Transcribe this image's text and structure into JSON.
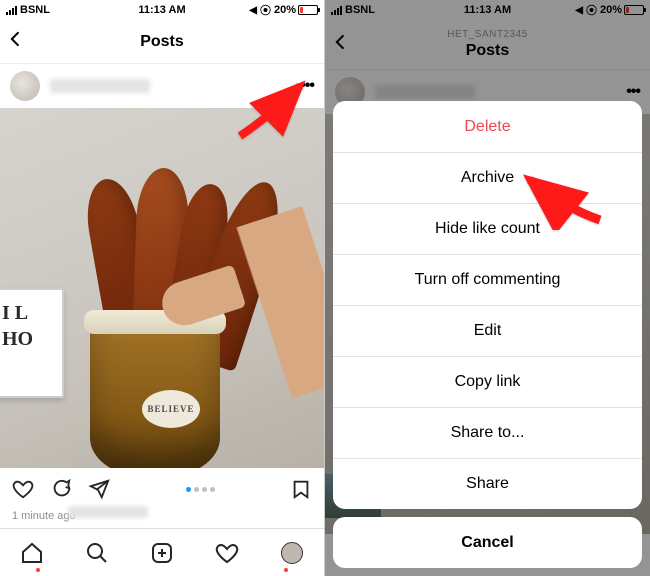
{
  "status": {
    "carrier": "BSNL",
    "time": "11:13 AM",
    "battery_pct": "20%"
  },
  "left": {
    "header": {
      "title": "Posts"
    },
    "post": {
      "tag_text": "BELIEVE",
      "sign_line1": "I L",
      "sign_line2": "HO",
      "timestamp": "1 minute ago",
      "pager_total": 4,
      "pager_active_index": 0
    }
  },
  "right": {
    "header": {
      "subtitle": "HET_SANT2345",
      "title": "Posts"
    },
    "bg_username": "hey_san12345",
    "sheet": {
      "items": [
        {
          "label": "Delete",
          "destructive": true
        },
        {
          "label": "Archive",
          "destructive": false
        },
        {
          "label": "Hide like count",
          "destructive": false
        },
        {
          "label": "Turn off commenting",
          "destructive": false
        },
        {
          "label": "Edit",
          "destructive": false
        },
        {
          "label": "Copy link",
          "destructive": false
        },
        {
          "label": "Share to...",
          "destructive": false
        },
        {
          "label": "Share",
          "destructive": false
        }
      ],
      "cancel": "Cancel"
    }
  }
}
